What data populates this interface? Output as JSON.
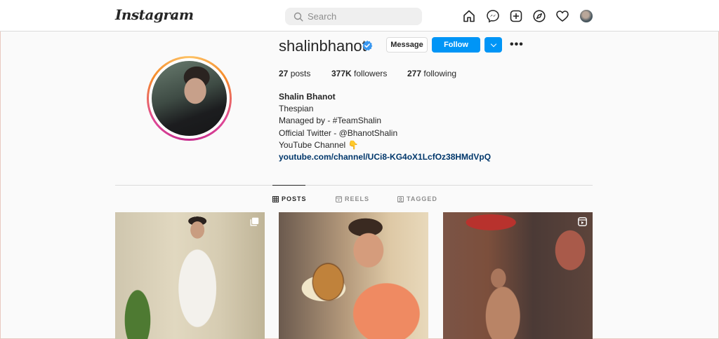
{
  "nav": {
    "logo": "Instagram",
    "search_placeholder": "Search"
  },
  "profile": {
    "username": "shalinbhanot",
    "verified": true,
    "message_label": "Message",
    "follow_label": "Follow",
    "more_label": "•••",
    "stats": {
      "posts_count": "27",
      "posts_label": "posts",
      "followers_count": "377K",
      "followers_label": "followers",
      "following_count": "277",
      "following_label": "following"
    },
    "bio": {
      "name": "Shalin Bhanot",
      "line1": "Thespian",
      "line2": "Managed by - #TeamShalin",
      "line3": "Official Twitter - @BhanotShalin",
      "line4": "YouTube Channel 👇",
      "link": "youtube.com/channel/UCi8-KG4oX1LcfOz38HMdVpQ"
    }
  },
  "tabs": [
    {
      "label": "POSTS",
      "icon": "grid-icon",
      "active": true
    },
    {
      "label": "REELS",
      "icon": "reels-icon",
      "active": false
    },
    {
      "label": "TAGGED",
      "icon": "tagged-icon",
      "active": false
    }
  ],
  "posts": [
    {
      "badge": "carousel-icon"
    },
    {
      "badge": ""
    },
    {
      "badge": "reel-icon"
    }
  ],
  "colors": {
    "accent": "#0095f6",
    "link": "#00376b",
    "text": "#262626",
    "muted": "#8e8e8e",
    "background": "#fafafa"
  }
}
